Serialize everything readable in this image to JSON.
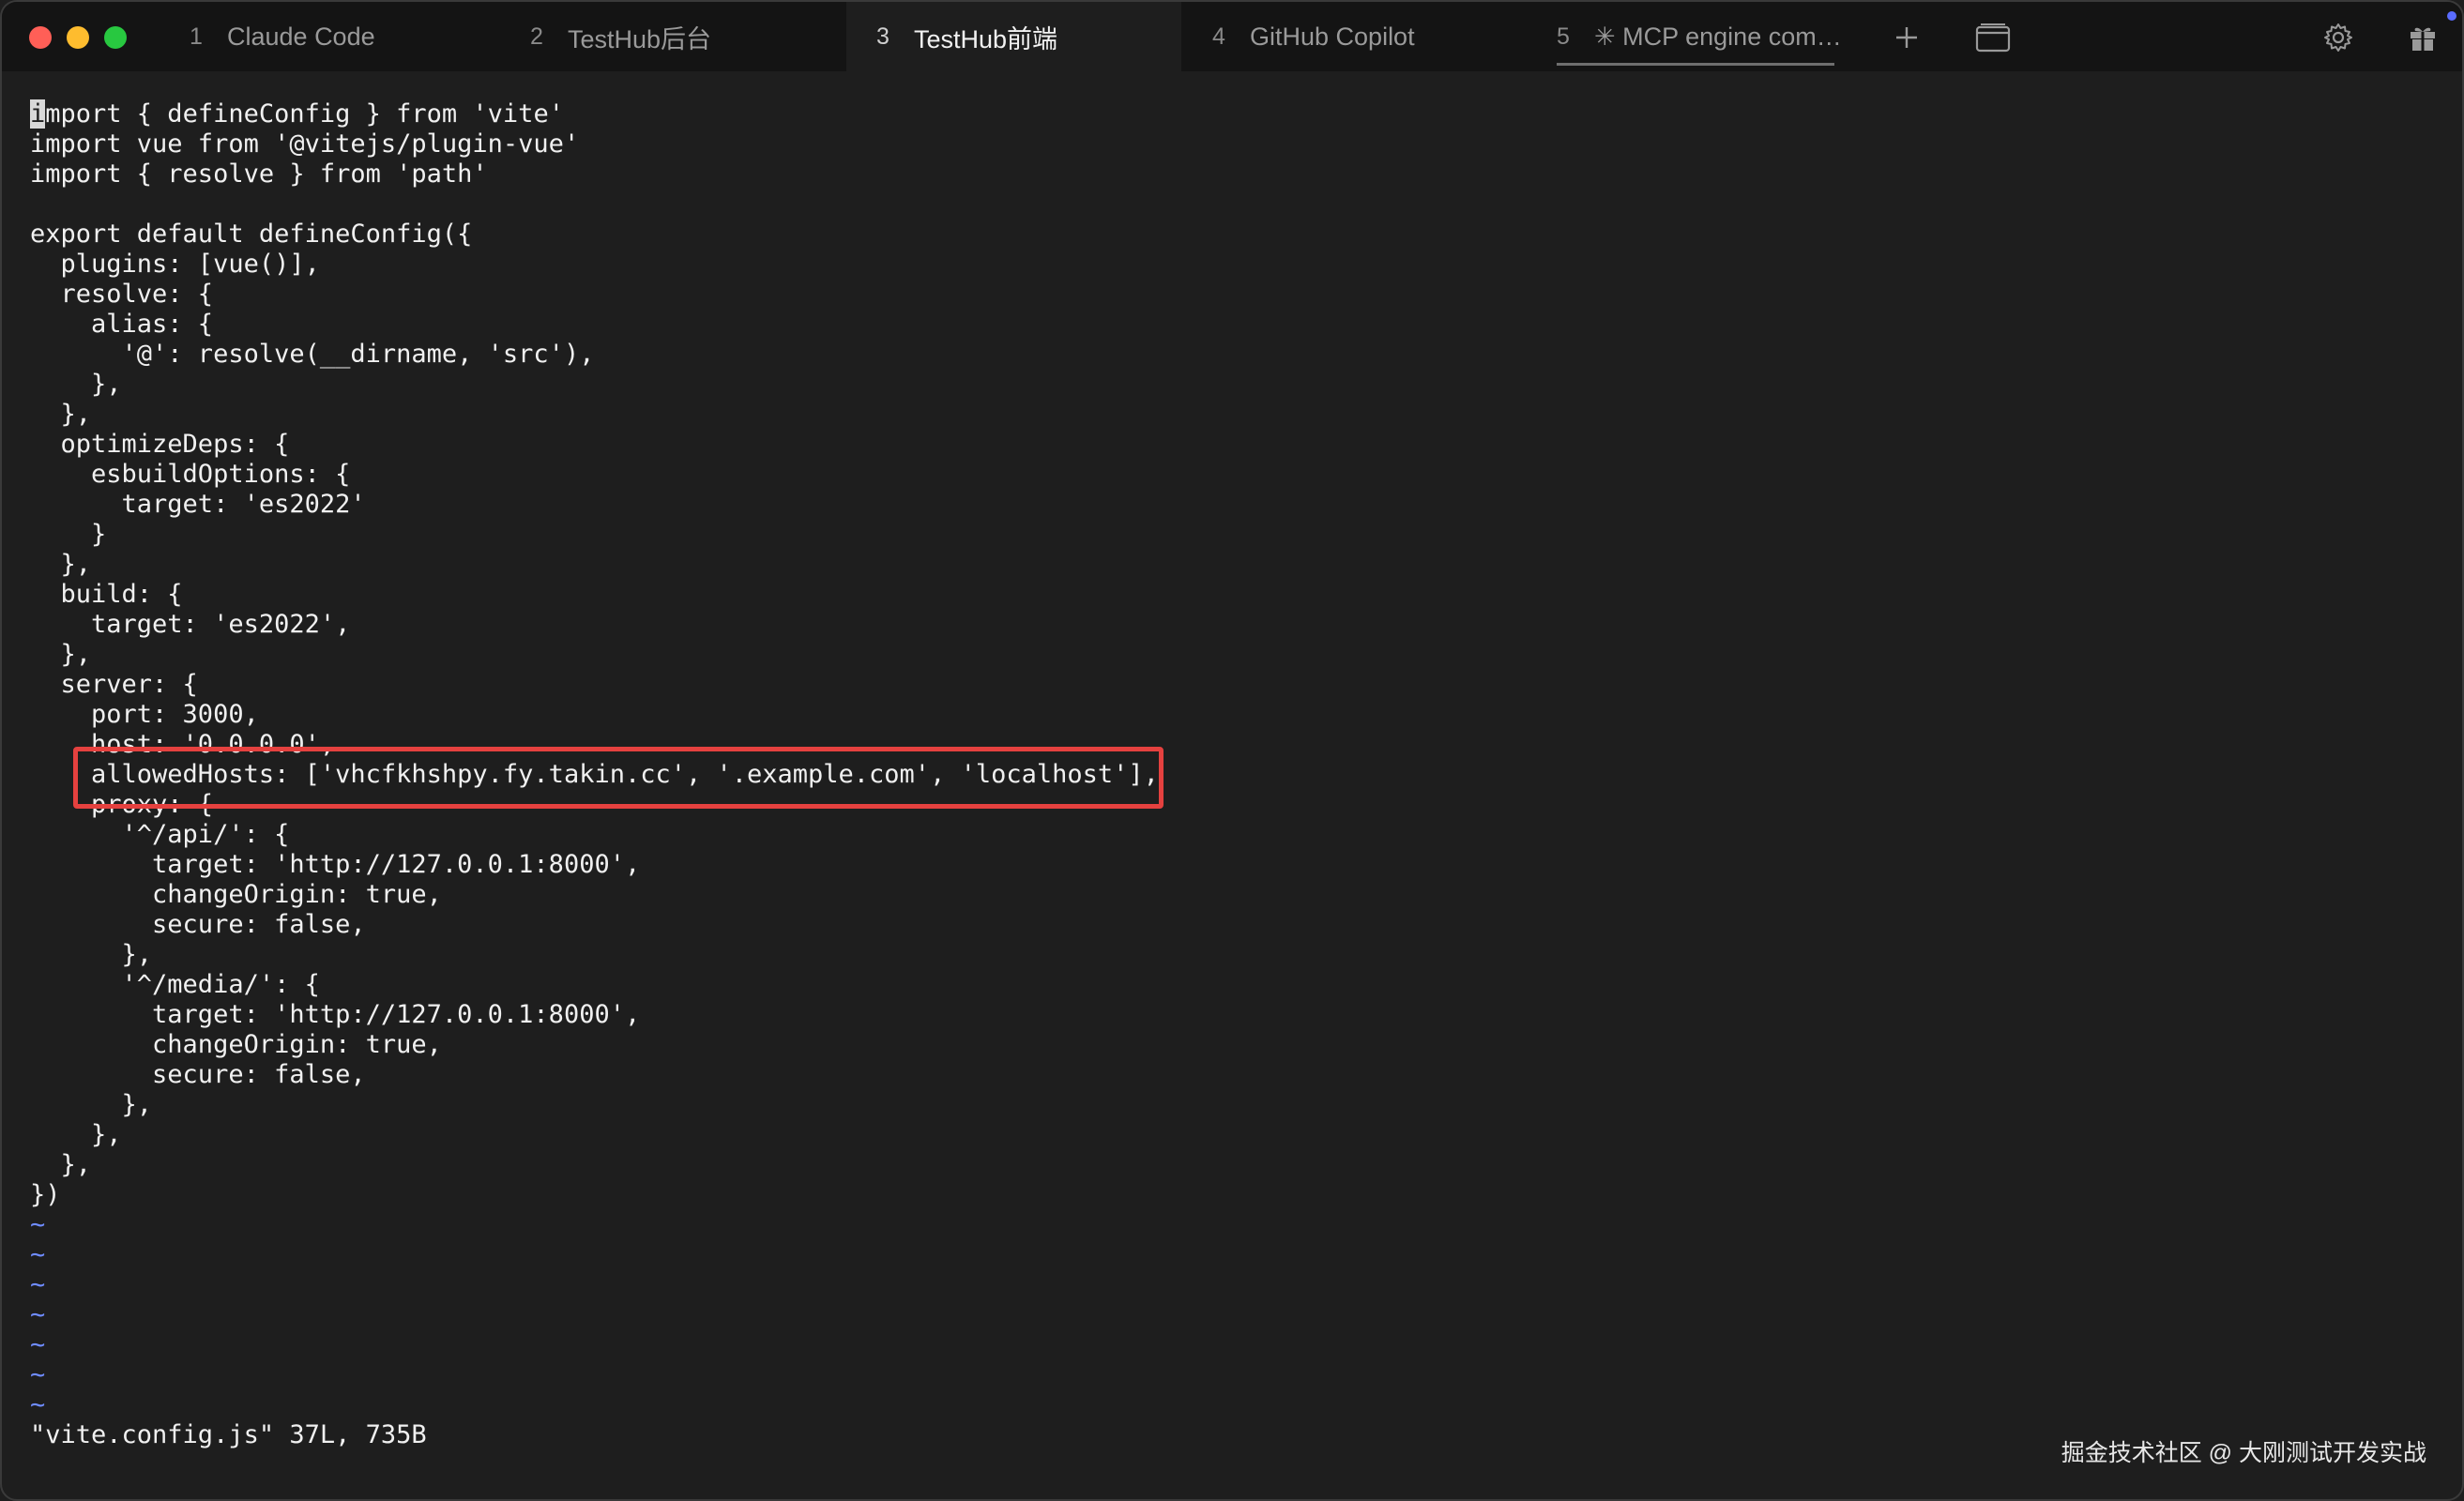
{
  "window": {
    "buttons": [
      "close",
      "minimize",
      "maximize"
    ],
    "colors": {
      "close": "#ff5f57",
      "minimize": "#febc2e",
      "maximize": "#28c840"
    }
  },
  "tabs": [
    {
      "num": "1",
      "label": "Claude Code",
      "active": false
    },
    {
      "num": "2",
      "label": "TestHub后台",
      "active": false
    },
    {
      "num": "3",
      "label": "TestHub前端",
      "active": true
    },
    {
      "num": "4",
      "label": "GitHub Copilot",
      "active": false
    },
    {
      "num": "5",
      "label": "✳ MCP engine com…",
      "active": false
    }
  ],
  "toolbar": {
    "icons": [
      "plus-icon",
      "window-icon",
      "gear-icon",
      "gift-icon"
    ],
    "notification_color": "#5a6cff"
  },
  "editor": {
    "lines": [
      "import { defineConfig } from 'vite'",
      "import vue from '@vitejs/plugin-vue'",
      "import { resolve } from 'path'",
      "",
      "export default defineConfig({",
      "  plugins: [vue()],",
      "  resolve: {",
      "    alias: {",
      "      '@': resolve(__dirname, 'src'),",
      "    },",
      "  },",
      "  optimizeDeps: {",
      "    esbuildOptions: {",
      "      target: 'es2022'",
      "    }",
      "  },",
      "  build: {",
      "    target: 'es2022',",
      "  },",
      "  server: {",
      "    port: 3000,",
      "    host: '0.0.0.0',",
      "    allowedHosts: ['vhcfkhshpy.fy.takin.cc', '.example.com', 'localhost'],",
      "    proxy: {",
      "      '^/api/': {",
      "        target: 'http://127.0.0.1:8000',",
      "        changeOrigin: true,",
      "        secure: false,",
      "      },",
      "      '^/media/': {",
      "        target: 'http://127.0.0.1:8000',",
      "        changeOrigin: true,",
      "        secure: false,",
      "      },",
      "    },",
      "  },",
      "})"
    ],
    "tildes": [
      "~",
      "~",
      "~",
      "~",
      "~",
      "~",
      "~"
    ],
    "status_line": "\"vite.config.js\" 37L, 735B",
    "highlight_color": "#e5413f",
    "tilde_color": "#6f8cff"
  },
  "watermark": "掘金技术社区 @ 大刚测试开发实战"
}
